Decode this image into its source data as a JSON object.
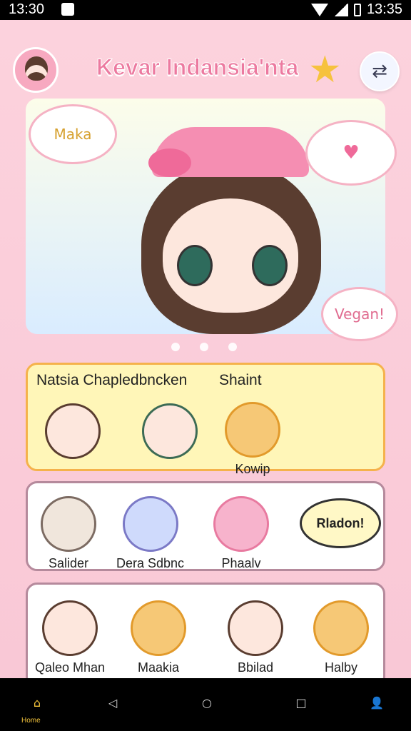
{
  "status": {
    "time_left": "13:30",
    "time_right": "13:35"
  },
  "header": {
    "title": "Kevar Indansia'nta"
  },
  "banner": {
    "bubble_left": "Maka",
    "bubble_vegan": "Vegan!"
  },
  "panels": {
    "panel1": {
      "title_left": "Natsia Chapledbncken",
      "title_right": "Shaint",
      "items": [
        {
          "label": ""
        },
        {
          "label": ""
        },
        {
          "label": "Kowip"
        }
      ]
    },
    "panel2": {
      "items": [
        {
          "label": "Salider"
        },
        {
          "label": "Dera Sdbnc"
        },
        {
          "label": "Phaalv"
        }
      ],
      "speech": "Rladon!"
    },
    "panel3": {
      "items": [
        {
          "label": "Qaleo Mhan"
        },
        {
          "label": "Maakia"
        },
        {
          "label": "Bbilad"
        },
        {
          "label": "Halby"
        }
      ]
    }
  },
  "navbar": {
    "home_label": "Home",
    "items": [
      "home-icon",
      "back-icon",
      "circle-icon",
      "square-icon",
      "profile-icon"
    ]
  }
}
